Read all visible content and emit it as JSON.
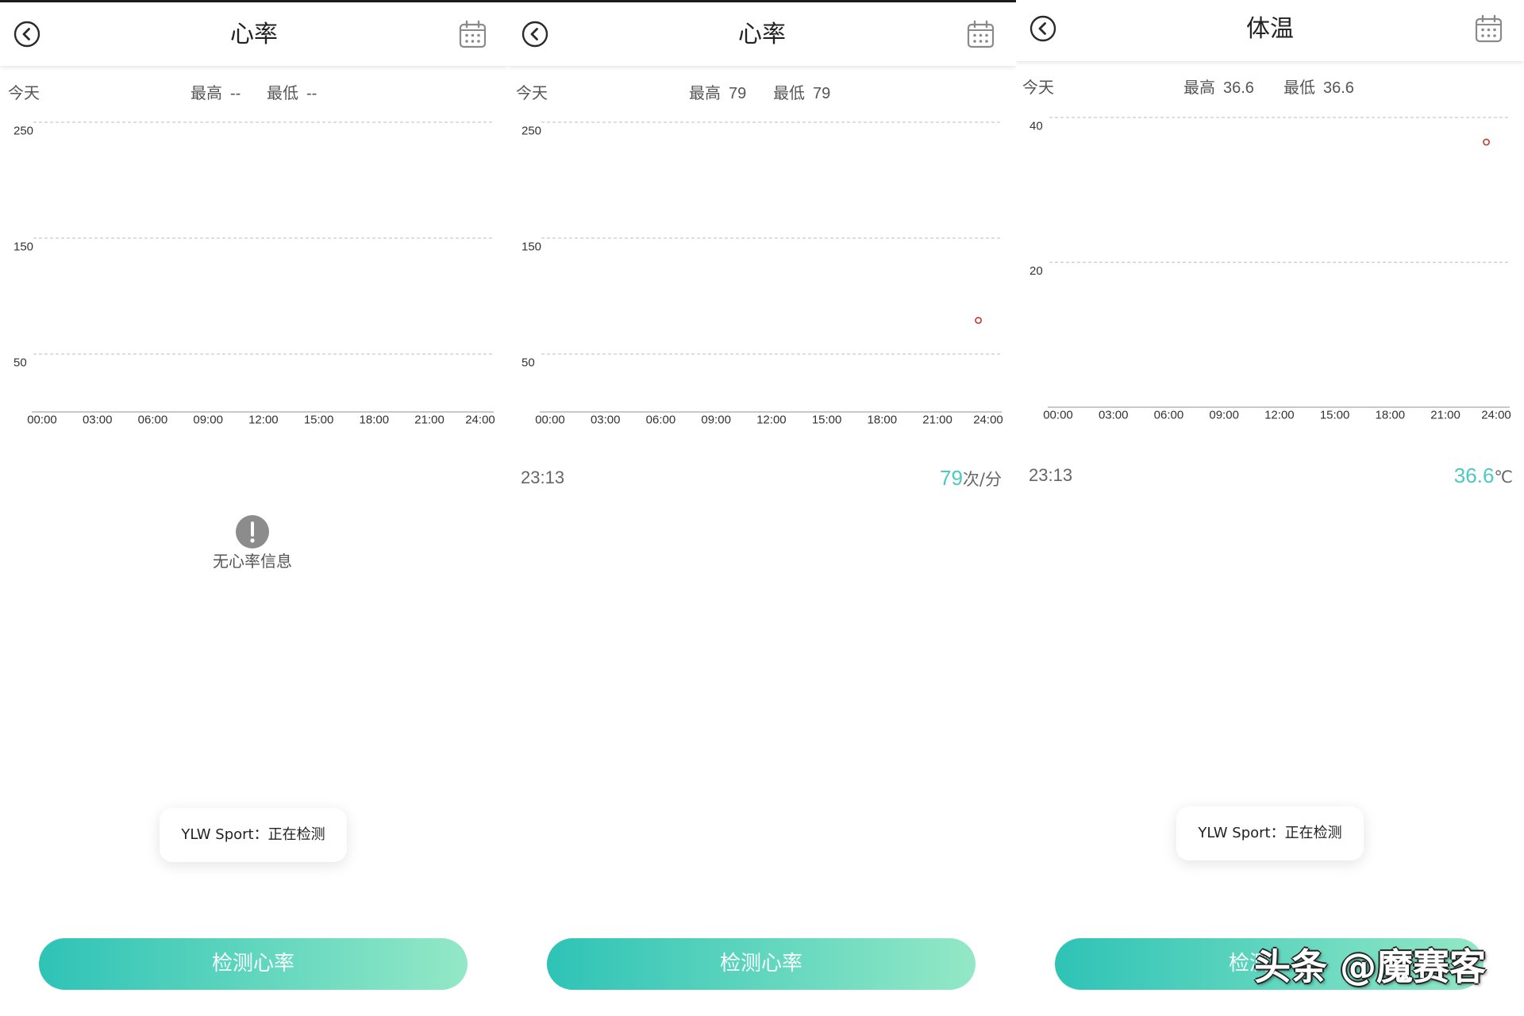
{
  "colors": {
    "accent_teal": "#4cc9c0",
    "button_gradient_start": "#2ec3b6",
    "button_gradient_end": "#93e8c6",
    "data_point": "#c0392b",
    "header_icon": "#8a8a8a"
  },
  "icons": {
    "back": "back-arrow-icon",
    "calendar": "calendar-icon",
    "empty_state": "exclamation-icon"
  },
  "watermark": "头条 @魔赛客",
  "panels": [
    {
      "title": "心率",
      "stats": {
        "period": "今天",
        "max_label": "最高",
        "max_value": "--",
        "min_label": "最低",
        "min_value": "--"
      },
      "empty_state": {
        "text": "无心率信息"
      },
      "toast": "YLW Sport：正在检测",
      "button_label": "检测心率"
    },
    {
      "title": "心率",
      "stats": {
        "period": "今天",
        "max_label": "最高",
        "max_value": "79",
        "min_label": "最低",
        "min_value": "79"
      },
      "readout": {
        "time": "23:13",
        "value": "79",
        "unit": "次/分"
      },
      "button_label": "检测心率"
    },
    {
      "title": "体温",
      "stats": {
        "period": "今天",
        "max_label": "最高",
        "max_value": "36.6",
        "min_label": "最低",
        "min_value": "36.6"
      },
      "readout": {
        "time": "23:13",
        "value": "36.6",
        "unit": "℃"
      },
      "toast": "YLW Sport：正在检测",
      "button_label": "检测"
    }
  ],
  "chart_data": [
    {
      "type": "scatter",
      "x_ticks": [
        "00:00",
        "03:00",
        "06:00",
        "09:00",
        "12:00",
        "15:00",
        "18:00",
        "21:00",
        "24:00"
      ],
      "y_ticks": [
        250,
        150,
        50
      ],
      "ylim": [
        0,
        250
      ],
      "grid": true,
      "points": []
    },
    {
      "type": "scatter",
      "x_ticks": [
        "00:00",
        "03:00",
        "06:00",
        "09:00",
        "12:00",
        "15:00",
        "18:00",
        "21:00",
        "24:00"
      ],
      "y_ticks": [
        250,
        150,
        50
      ],
      "ylim": [
        0,
        250
      ],
      "grid": true,
      "points": [
        {
          "x": "23:13",
          "y": 79
        }
      ]
    },
    {
      "type": "scatter",
      "x_ticks": [
        "00:00",
        "03:00",
        "06:00",
        "09:00",
        "12:00",
        "15:00",
        "18:00",
        "21:00",
        "24:00"
      ],
      "y_ticks": [
        40,
        20
      ],
      "ylim": [
        0,
        40
      ],
      "grid": true,
      "points": [
        {
          "x": "23:13",
          "y": 36.6
        }
      ]
    }
  ]
}
